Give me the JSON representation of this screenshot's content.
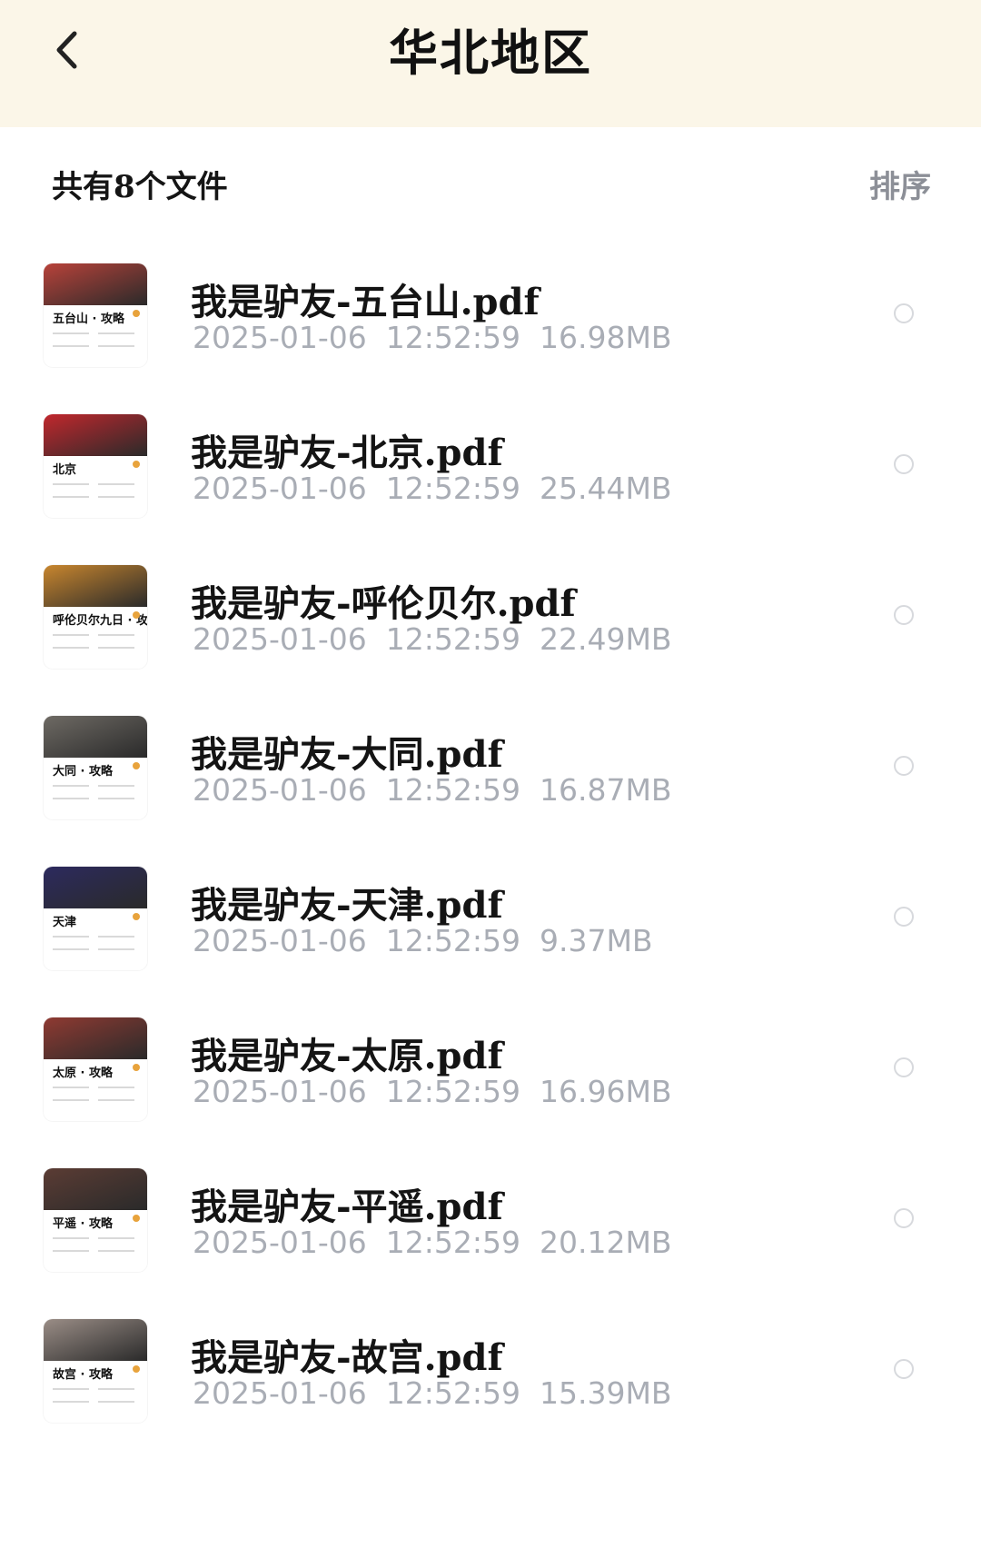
{
  "header": {
    "title": "华北地区",
    "back_icon": "chevron-left-icon"
  },
  "summary": {
    "count_label": "共有8个文件",
    "sort_label": "排序"
  },
  "files": [
    {
      "name": "我是驴友-五台山.pdf",
      "date": "2025-01-06",
      "time": "12:52:59",
      "size": "16.98MB",
      "thumb_text": "五台山 · 攻略",
      "thumb_color": "#b8423a"
    },
    {
      "name": "我是驴友-北京.pdf",
      "date": "2025-01-06",
      "time": "12:52:59",
      "size": "25.44MB",
      "thumb_text": "北京",
      "thumb_color": "#c1272d"
    },
    {
      "name": "我是驴友-呼伦贝尔.pdf",
      "date": "2025-01-06",
      "time": "12:52:59",
      "size": "22.49MB",
      "thumb_text": "呼伦贝尔九日 · 攻略",
      "thumb_color": "#c8862e"
    },
    {
      "name": "我是驴友-大同.pdf",
      "date": "2025-01-06",
      "time": "12:52:59",
      "size": "16.87MB",
      "thumb_text": "大同 · 攻略",
      "thumb_color": "#6e6a64"
    },
    {
      "name": "我是驴友-天津.pdf",
      "date": "2025-01-06",
      "time": "12:52:59",
      "size": "9.37MB",
      "thumb_text": "天津",
      "thumb_color": "#2c2a5e"
    },
    {
      "name": "我是驴友-太原.pdf",
      "date": "2025-01-06",
      "time": "12:52:59",
      "size": "16.96MB",
      "thumb_text": "太原 · 攻略",
      "thumb_color": "#8f3a32"
    },
    {
      "name": "我是驴友-平遥.pdf",
      "date": "2025-01-06",
      "time": "12:52:59",
      "size": "20.12MB",
      "thumb_text": "平遥 · 攻略",
      "thumb_color": "#5b3c34"
    },
    {
      "name": "我是驴友-故宫.pdf",
      "date": "2025-01-06",
      "time": "12:52:59",
      "size": "15.39MB",
      "thumb_text": "故宫 · 攻略",
      "thumb_color": "#9a8d86"
    }
  ],
  "colors": {
    "header_bg": "#fbf6e8",
    "title_text": "#111111",
    "meta_text": "#a9adb5",
    "sort_text": "#8c8f97",
    "radio_border": "#d7d9dd"
  }
}
